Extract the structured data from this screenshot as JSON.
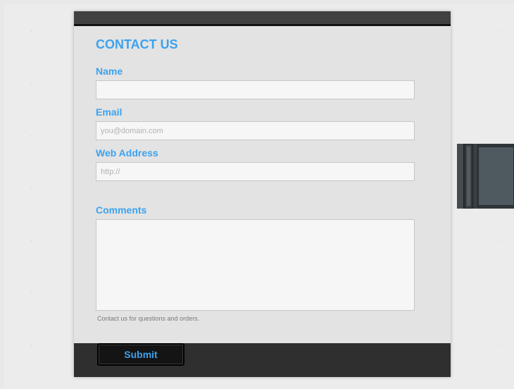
{
  "form": {
    "title": "CONTACT US",
    "name_label": "Name",
    "name_value": "",
    "email_label": "Email",
    "email_placeholder": "you@domain.com",
    "web_label": "Web Address",
    "web_placeholder": "http://",
    "comments_label": "Comments",
    "comments_value": "",
    "help_text": "Contact us for questions and orders.",
    "submit_label": "Submit"
  },
  "colors": {
    "accent": "#3ca2ee",
    "card_background": "#e3e3e3",
    "header_footer": "#2f2f2f",
    "input_background": "#f6f6f6"
  }
}
